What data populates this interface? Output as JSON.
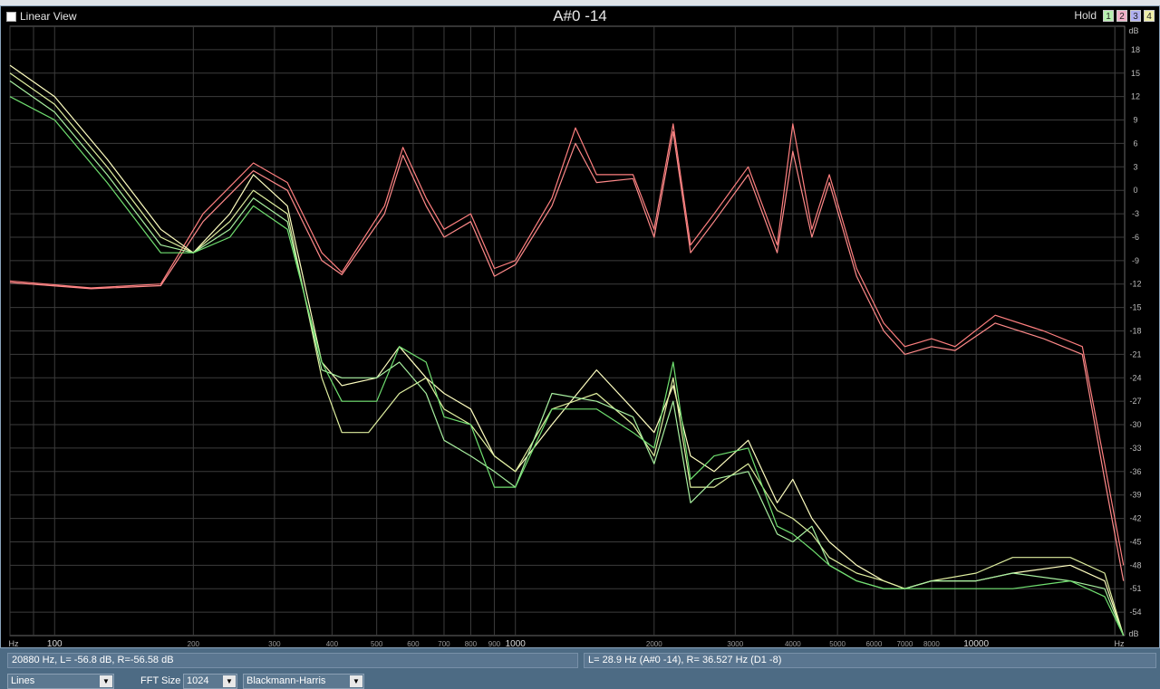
{
  "header": {
    "linear_view_label": "Linear View",
    "title": "A#0 -14",
    "hold_label": "Hold",
    "hold_buttons": [
      {
        "label": "1",
        "color": "#b8f0b0"
      },
      {
        "label": "2",
        "color": "#f0b0c8"
      },
      {
        "label": "3",
        "color": "#b0b0f0"
      },
      {
        "label": "4",
        "color": "#f0f0a8"
      }
    ]
  },
  "axes": {
    "y_unit": "dB",
    "x_unit": "Hz",
    "y_ticks": [
      "18",
      "15",
      "12",
      "9",
      "6",
      "3",
      "0",
      "-3",
      "-6",
      "-9",
      "-12",
      "-15",
      "-18",
      "-21",
      "-24",
      "-27",
      "-30",
      "-33",
      "-36",
      "-39",
      "-42",
      "-45",
      "-48",
      "-51",
      "-54"
    ],
    "x_ticks": [
      "100",
      "200",
      "300",
      "400",
      "500",
      "600",
      "700",
      "800",
      "900",
      "1000",
      "2000",
      "3000",
      "4000",
      "5000",
      "6000",
      "7000",
      "8000",
      "10000"
    ]
  },
  "chart_data": {
    "type": "line",
    "xlabel": "Hz",
    "ylabel": "dB",
    "x_scale": "log",
    "xlim": [
      80,
      21000
    ],
    "ylim": [
      -57,
      21
    ],
    "grid": true,
    "series": [
      {
        "color": "#ff7f7f",
        "points": [
          [
            80,
            -11.6
          ],
          [
            120,
            -12.5
          ],
          [
            170,
            -12
          ],
          [
            210,
            -3
          ],
          [
            270,
            3.5
          ],
          [
            320,
            1
          ],
          [
            380,
            -8
          ],
          [
            420,
            -10.5
          ],
          [
            520,
            -2
          ],
          [
            570,
            5.5
          ],
          [
            640,
            -1
          ],
          [
            700,
            -5
          ],
          [
            800,
            -3
          ],
          [
            900,
            -10
          ],
          [
            1000,
            -9
          ],
          [
            1200,
            -1
          ],
          [
            1350,
            8
          ],
          [
            1500,
            2
          ],
          [
            1800,
            2
          ],
          [
            2000,
            -5
          ],
          [
            2200,
            8.5
          ],
          [
            2400,
            -7
          ],
          [
            2700,
            -3
          ],
          [
            3200,
            3
          ],
          [
            3700,
            -7
          ],
          [
            4000,
            8.5
          ],
          [
            4400,
            -5
          ],
          [
            4800,
            2
          ],
          [
            5500,
            -10
          ],
          [
            6300,
            -17
          ],
          [
            7000,
            -20
          ],
          [
            8000,
            -19
          ],
          [
            9000,
            -20
          ],
          [
            11000,
            -16
          ],
          [
            14000,
            -18
          ],
          [
            17000,
            -20
          ],
          [
            19000,
            -35
          ],
          [
            20880,
            -48
          ]
        ]
      },
      {
        "color": "#ff8a8a",
        "points": [
          [
            80,
            -11.8
          ],
          [
            120,
            -12.6
          ],
          [
            170,
            -12.2
          ],
          [
            210,
            -4
          ],
          [
            270,
            2.5
          ],
          [
            320,
            0
          ],
          [
            380,
            -9
          ],
          [
            420,
            -10.8
          ],
          [
            520,
            -3
          ],
          [
            570,
            4.5
          ],
          [
            640,
            -2
          ],
          [
            700,
            -6
          ],
          [
            800,
            -4
          ],
          [
            900,
            -11
          ],
          [
            1000,
            -9.5
          ],
          [
            1200,
            -2
          ],
          [
            1350,
            6
          ],
          [
            1500,
            1
          ],
          [
            1800,
            1.5
          ],
          [
            2000,
            -6
          ],
          [
            2200,
            7.5
          ],
          [
            2400,
            -8
          ],
          [
            2700,
            -4
          ],
          [
            3200,
            2
          ],
          [
            3700,
            -8
          ],
          [
            4000,
            5
          ],
          [
            4400,
            -6
          ],
          [
            4800,
            1
          ],
          [
            5500,
            -11
          ],
          [
            6300,
            -18
          ],
          [
            7000,
            -21
          ],
          [
            8000,
            -20
          ],
          [
            9000,
            -20.5
          ],
          [
            11000,
            -17
          ],
          [
            14000,
            -19
          ],
          [
            17000,
            -21
          ],
          [
            19000,
            -37
          ],
          [
            20880,
            -50
          ]
        ]
      },
      {
        "color": "#ffffc0",
        "points": [
          [
            80,
            16
          ],
          [
            100,
            12
          ],
          [
            130,
            4
          ],
          [
            170,
            -5
          ],
          [
            200,
            -8
          ],
          [
            240,
            -3
          ],
          [
            270,
            2
          ],
          [
            320,
            -2
          ],
          [
            380,
            -22
          ],
          [
            420,
            -25
          ],
          [
            500,
            -24
          ],
          [
            560,
            -20
          ],
          [
            640,
            -24
          ],
          [
            700,
            -26
          ],
          [
            800,
            -28
          ],
          [
            900,
            -34
          ],
          [
            1000,
            -36
          ],
          [
            1200,
            -30
          ],
          [
            1500,
            -23
          ],
          [
            1800,
            -28
          ],
          [
            2000,
            -31
          ],
          [
            2200,
            -25
          ],
          [
            2400,
            -34
          ],
          [
            2700,
            -36
          ],
          [
            3200,
            -32
          ],
          [
            3700,
            -40
          ],
          [
            4000,
            -37
          ],
          [
            4400,
            -42
          ],
          [
            4800,
            -45
          ],
          [
            5500,
            -48
          ],
          [
            6300,
            -50
          ],
          [
            7000,
            -51
          ],
          [
            8000,
            -50
          ],
          [
            10000,
            -50
          ],
          [
            12000,
            -49
          ],
          [
            16000,
            -48
          ],
          [
            19000,
            -50
          ],
          [
            20880,
            -57
          ]
        ]
      },
      {
        "color": "#e0f0a0",
        "points": [
          [
            80,
            15
          ],
          [
            100,
            11
          ],
          [
            130,
            3
          ],
          [
            170,
            -6
          ],
          [
            200,
            -8
          ],
          [
            240,
            -4
          ],
          [
            270,
            0
          ],
          [
            320,
            -3
          ],
          [
            380,
            -24
          ],
          [
            420,
            -31
          ],
          [
            480,
            -31
          ],
          [
            560,
            -26
          ],
          [
            640,
            -24
          ],
          [
            700,
            -28
          ],
          [
            800,
            -30
          ],
          [
            900,
            -34
          ],
          [
            1000,
            -36
          ],
          [
            1200,
            -28
          ],
          [
            1500,
            -26
          ],
          [
            1800,
            -30
          ],
          [
            2000,
            -34
          ],
          [
            2200,
            -24
          ],
          [
            2400,
            -38
          ],
          [
            2700,
            -38
          ],
          [
            3200,
            -35
          ],
          [
            3700,
            -41
          ],
          [
            4000,
            -42
          ],
          [
            4400,
            -44
          ],
          [
            4800,
            -47
          ],
          [
            5500,
            -49
          ],
          [
            6300,
            -50
          ],
          [
            7000,
            -51
          ],
          [
            8000,
            -50
          ],
          [
            10000,
            -49
          ],
          [
            12000,
            -47
          ],
          [
            16000,
            -47
          ],
          [
            19000,
            -49
          ],
          [
            20880,
            -57
          ]
        ]
      },
      {
        "color": "#a8f0a0",
        "points": [
          [
            80,
            14
          ],
          [
            100,
            10
          ],
          [
            130,
            2
          ],
          [
            170,
            -7
          ],
          [
            200,
            -8
          ],
          [
            240,
            -5
          ],
          [
            270,
            -1
          ],
          [
            320,
            -4
          ],
          [
            380,
            -23
          ],
          [
            420,
            -24
          ],
          [
            500,
            -24
          ],
          [
            560,
            -22
          ],
          [
            640,
            -26
          ],
          [
            700,
            -32
          ],
          [
            800,
            -34
          ],
          [
            900,
            -36
          ],
          [
            1000,
            -38
          ],
          [
            1200,
            -26
          ],
          [
            1500,
            -27
          ],
          [
            1800,
            -29
          ],
          [
            2000,
            -35
          ],
          [
            2200,
            -27
          ],
          [
            2400,
            -40
          ],
          [
            2700,
            -37
          ],
          [
            3200,
            -36
          ],
          [
            3700,
            -44
          ],
          [
            4000,
            -45
          ],
          [
            4400,
            -43
          ],
          [
            4800,
            -48
          ],
          [
            5500,
            -50
          ],
          [
            6300,
            -51
          ],
          [
            7000,
            -51
          ],
          [
            8000,
            -50
          ],
          [
            10000,
            -50
          ],
          [
            12000,
            -49
          ],
          [
            16000,
            -50
          ],
          [
            19000,
            -51
          ],
          [
            20880,
            -57
          ]
        ]
      },
      {
        "color": "#70e070",
        "points": [
          [
            80,
            12
          ],
          [
            100,
            9
          ],
          [
            130,
            1
          ],
          [
            170,
            -8
          ],
          [
            200,
            -8
          ],
          [
            240,
            -6
          ],
          [
            270,
            -2
          ],
          [
            320,
            -5
          ],
          [
            380,
            -22
          ],
          [
            420,
            -27
          ],
          [
            500,
            -27
          ],
          [
            560,
            -20
          ],
          [
            640,
            -22
          ],
          [
            700,
            -29
          ],
          [
            800,
            -30
          ],
          [
            900,
            -38
          ],
          [
            1000,
            -38
          ],
          [
            1200,
            -28
          ],
          [
            1500,
            -28
          ],
          [
            1800,
            -31
          ],
          [
            2000,
            -33
          ],
          [
            2200,
            -22
          ],
          [
            2400,
            -37
          ],
          [
            2700,
            -34
          ],
          [
            3200,
            -33
          ],
          [
            3700,
            -43
          ],
          [
            4000,
            -44
          ],
          [
            4400,
            -46
          ],
          [
            4800,
            -48
          ],
          [
            5500,
            -50
          ],
          [
            6300,
            -51
          ],
          [
            7000,
            -51
          ],
          [
            8000,
            -51
          ],
          [
            10000,
            -51
          ],
          [
            12000,
            -51
          ],
          [
            16000,
            -50
          ],
          [
            19000,
            -52
          ],
          [
            20880,
            -57
          ]
        ]
      }
    ]
  },
  "status": {
    "left_readout": "20880 Hz, L= -56.8 dB, R=-56.58 dB",
    "right_readout": "L=   28.9 Hz (A#0 -14), R= 36.527 Hz (D1 -8)"
  },
  "controls": {
    "display_mode": "Lines",
    "fft_size_label": "FFT Size",
    "fft_size_value": "1024",
    "window_function": "Blackmann-Harris"
  }
}
